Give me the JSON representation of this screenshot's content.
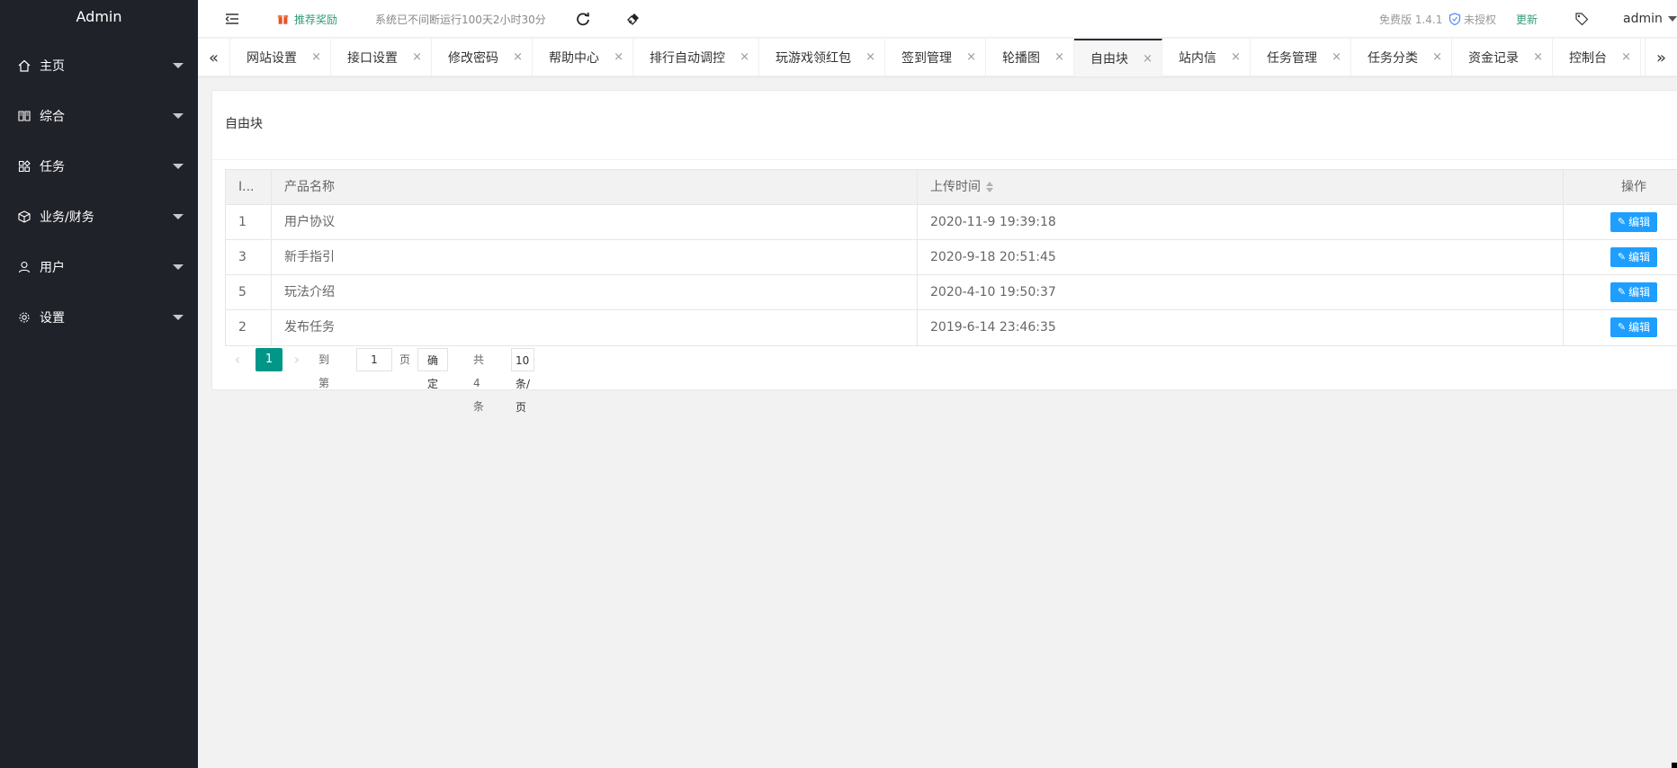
{
  "sidebar": {
    "logo": "Admin",
    "items": [
      {
        "label": "主页",
        "icon": "home-icon"
      },
      {
        "label": "综合",
        "icon": "reading-icon"
      },
      {
        "label": "任务",
        "icon": "app-icon"
      },
      {
        "label": "业务/财务",
        "icon": "component-icon"
      },
      {
        "label": "用户",
        "icon": "user-icon"
      },
      {
        "label": "设置",
        "icon": "settings-icon"
      }
    ]
  },
  "header": {
    "recommend_label": "推荐奖励",
    "runtime_text": "系统已不间断运行100天2小时30分",
    "version": "免费版 1.4.1",
    "unauth": "未授权",
    "update": "更新",
    "user": "admin"
  },
  "tabs": {
    "prev": "«",
    "next": "»",
    "close": "×",
    "items": [
      {
        "label": "网站设置"
      },
      {
        "label": "接口设置"
      },
      {
        "label": "修改密码"
      },
      {
        "label": "帮助中心"
      },
      {
        "label": "排行自动调控"
      },
      {
        "label": "玩游戏领红包"
      },
      {
        "label": "签到管理"
      },
      {
        "label": "轮播图"
      },
      {
        "label": "自由块",
        "active": true
      },
      {
        "label": "站内信"
      },
      {
        "label": "任务管理"
      },
      {
        "label": "任务分类"
      },
      {
        "label": "资金记录"
      },
      {
        "label": "控制台"
      }
    ]
  },
  "card": {
    "title": "自由块"
  },
  "table": {
    "columns": [
      "I...",
      "产品名称",
      "上传时间",
      "操作"
    ],
    "edit_label": "编辑",
    "rows": [
      {
        "id": "1",
        "name": "用户协议",
        "time": "2020-11-9 19:39:18"
      },
      {
        "id": "3",
        "name": "新手指引",
        "time": "2020-9-18 20:51:45"
      },
      {
        "id": "5",
        "name": "玩法介绍",
        "time": "2020-4-10 19:50:37"
      },
      {
        "id": "2",
        "name": "发布任务",
        "time": "2019-6-14 23:46:35"
      }
    ]
  },
  "pager": {
    "prev": "‹",
    "next": "›",
    "current": "1",
    "goto_prefix": "到第",
    "goto_value": "1",
    "goto_suffix": "页",
    "confirm": "确定",
    "total": "共 4 条",
    "limit": "10 条/页"
  },
  "colors": {
    "sidebar_bg": "#20222a",
    "accent": "#009688",
    "edit_button": "#1e9fff"
  }
}
